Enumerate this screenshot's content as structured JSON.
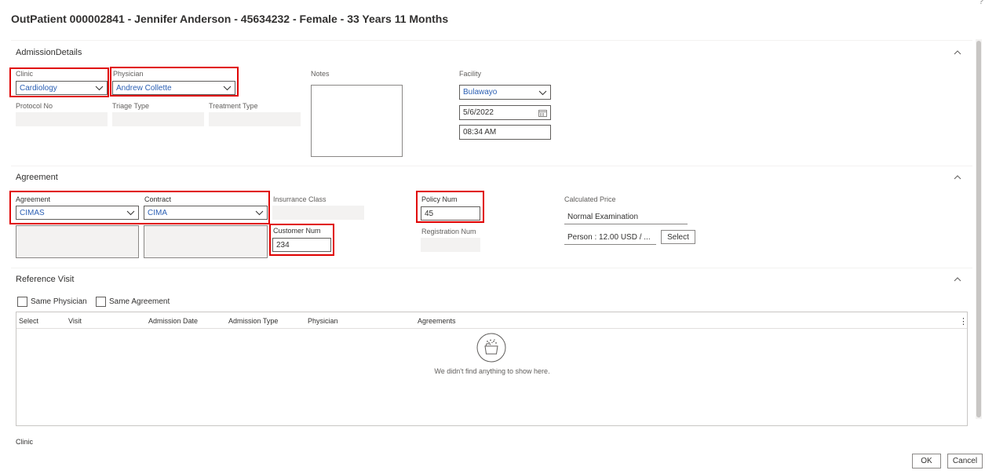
{
  "header": {
    "title": "OutPatient 000002841 - Jennifer Anderson - 45634232 - Female - 33 Years 11 Months",
    "help": "?"
  },
  "admission": {
    "section_title": "AdmissionDetails",
    "clinic_label": "Clinic",
    "clinic_value": "Cardiology",
    "physician_label": "Physician",
    "physician_value": "Andrew Collette",
    "protocol_label": "Protocol No",
    "triage_label": "Triage Type",
    "treatment_label": "Treatment Type",
    "notes_label": "Notes",
    "facility_label": "Facility",
    "facility_value": "Bulawayo",
    "date_value": "5/6/2022",
    "time_value": "08:34 AM"
  },
  "agreement": {
    "section_title": "Agreement",
    "agreement_label": "Agreement",
    "agreement_value": "CIMAS",
    "contract_label": "Contract",
    "contract_value": "CIMA",
    "insurance_class_label": "Insurrance Class",
    "customer_num_label": "Customer Num",
    "customer_num_value": "234",
    "policy_num_label": "Policy Num",
    "policy_num_value": "45",
    "registration_num_label": "Registration Num",
    "calculated_price_label": "Calculated Price",
    "calculated_price_name": "Normal Examination",
    "calculated_price_detail": "Person : 12.00 USD / ...",
    "select_label": "Select"
  },
  "reference_visit": {
    "section_title": "Reference Visit",
    "same_physician_label": "Same Physician",
    "same_agreement_label": "Same Agreement",
    "columns": [
      "Select",
      "Visit",
      "Admission Date",
      "Admission Type",
      "Physician",
      "Agreements"
    ],
    "more_icon": "⋮",
    "empty_message": "We didn't find anything to show here."
  },
  "footer": {
    "clinic_label": "Clinic",
    "ok_label": "OK",
    "cancel_label": "Cancel"
  },
  "colors": {
    "highlight": "#e00000",
    "link_blue": "#2b5fb3",
    "readonly_bg": "#f3f2f1"
  }
}
